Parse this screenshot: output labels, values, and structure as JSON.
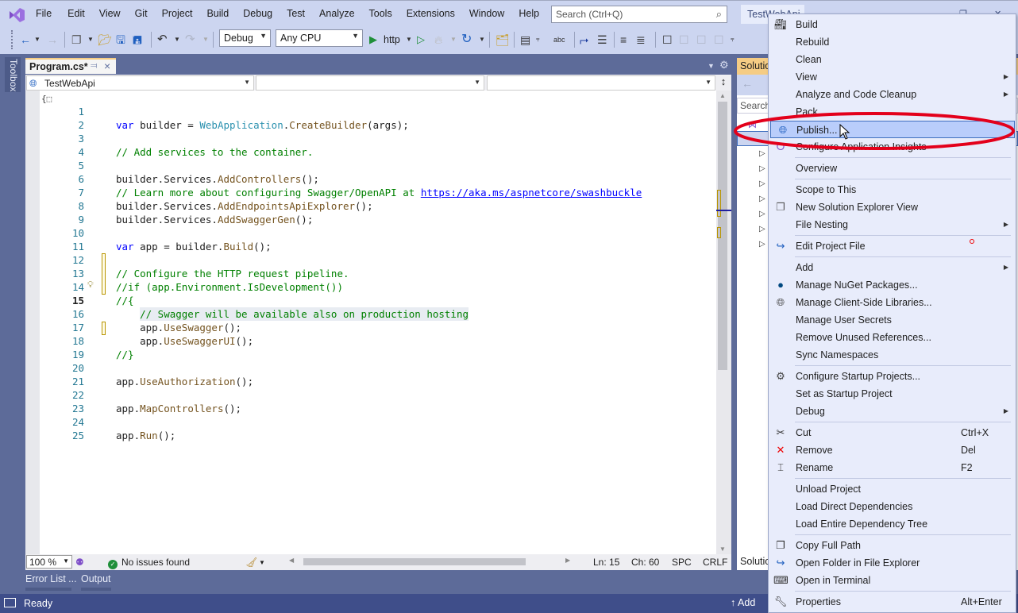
{
  "app": {
    "title_tab": "TestWebApi",
    "accent_color": "#68217a",
    "status_bar_color": "#3f4e8a"
  },
  "menu": [
    "File",
    "Edit",
    "View",
    "Git",
    "Project",
    "Build",
    "Debug",
    "Test",
    "Analyze",
    "Tools",
    "Extensions",
    "Window",
    "Help"
  ],
  "search": {
    "placeholder": "Search (Ctrl+Q)"
  },
  "toolbar": {
    "configuration": "Debug",
    "platform": "Any CPU",
    "run_target": "http"
  },
  "toolbox": {
    "label": "Toolbox"
  },
  "editor": {
    "tab_label": "Program.cs*",
    "nav_project": "TestWebApi",
    "nav_type": "",
    "nav_member": "",
    "current_line": 15,
    "lines": [
      {
        "n": "1"
      },
      {
        "n": "2"
      },
      {
        "n": "3"
      },
      {
        "n": "4"
      },
      {
        "n": "5"
      },
      {
        "n": "6"
      },
      {
        "n": "7"
      },
      {
        "n": "8"
      },
      {
        "n": "9"
      },
      {
        "n": "10"
      },
      {
        "n": "11"
      },
      {
        "n": "12"
      },
      {
        "n": "13"
      },
      {
        "n": "14"
      },
      {
        "n": "15"
      },
      {
        "n": "16"
      },
      {
        "n": "17"
      },
      {
        "n": "18"
      },
      {
        "n": "19"
      },
      {
        "n": "20"
      },
      {
        "n": "21"
      },
      {
        "n": "22"
      },
      {
        "n": "23"
      },
      {
        "n": "24"
      },
      {
        "n": "25"
      }
    ],
    "code": {
      "l1_kw": "var",
      "l1_a": " builder = ",
      "l1_ty": "WebApplication",
      "l1_b": ".",
      "l1_me": "CreateBuilder",
      "l1_c": "(args);",
      "l3": "// Add services to the container.",
      "l5_a": "builder.Services.",
      "l5_me": "AddControllers",
      "l5_b": "();",
      "l6_a": "// Learn more about configuring Swagger/OpenAPI at ",
      "l6_link": "https://aka.ms/aspnetcore/swashbuckle",
      "l7_a": "builder.Services.",
      "l7_me": "AddEndpointsApiExplorer",
      "l7_b": "();",
      "l8_a": "builder.Services.",
      "l8_me": "AddSwaggerGen",
      "l8_b": "();",
      "l10_kw": "var",
      "l10_a": " app = builder.",
      "l10_me": "Build",
      "l10_b": "();",
      "l12": "// Configure the HTTP request pipeline.",
      "l13": "//if (app.Environment.IsDevelopment())",
      "l14": "//{",
      "l15": "    // Swagger will be available also on production hosting",
      "l16_a": "    app.",
      "l16_me": "UseSwagger",
      "l16_b": "();",
      "l17_a": "    app.",
      "l17_me": "UseSwaggerUI",
      "l17_b": "();",
      "l18": "//}",
      "l20_a": "app.",
      "l20_me": "UseAuthorization",
      "l20_b": "();",
      "l22_a": "app.",
      "l22_me": "MapControllers",
      "l22_b": "();",
      "l24_a": "app.",
      "l24_me": "Run",
      "l24_b": "();"
    }
  },
  "editor_status": {
    "zoom": "100 %",
    "issues": "No issues found",
    "line": "Ln: 15",
    "char": "Ch: 60",
    "whitespace": "SPC",
    "line_ending": "CRLF"
  },
  "bottom_tabs": [
    "Error List ...",
    "Output"
  ],
  "statusbar": {
    "ready": "Ready",
    "add_to_source": "Add"
  },
  "solution_explorer": {
    "title": "Solution Explorer",
    "search_placeholder": "Search",
    "bottom_tab": "Solution"
  },
  "context_menu": {
    "items": [
      {
        "label": "Build",
        "icon": "build-icon"
      },
      {
        "label": "Rebuild"
      },
      {
        "label": "Clean"
      },
      {
        "label": "View",
        "submenu": true
      },
      {
        "label": "Analyze and Code Cleanup",
        "submenu": true
      },
      {
        "label": "Pack"
      },
      {
        "label": "Publish...",
        "icon": "globe-publish-icon",
        "highlighted": true
      },
      {
        "label": "Configure Application Insights",
        "icon": "app-insights-icon"
      },
      {
        "label": "Overview"
      },
      {
        "label": "Scope to This"
      },
      {
        "label": "New Solution Explorer View",
        "icon": "new-view-icon"
      },
      {
        "label": "File Nesting",
        "submenu": true
      },
      {
        "label": "Edit Project File",
        "icon": "edit-project-icon"
      },
      {
        "label": "Add",
        "submenu": true
      },
      {
        "label": "Manage NuGet Packages...",
        "icon": "nuget-icon"
      },
      {
        "label": "Manage Client-Side Libraries...",
        "icon": "client-libs-icon"
      },
      {
        "label": "Manage User Secrets"
      },
      {
        "label": "Remove Unused References..."
      },
      {
        "label": "Sync Namespaces"
      },
      {
        "label": "Configure Startup Projects...",
        "icon": "gear-icon"
      },
      {
        "label": "Set as Startup Project"
      },
      {
        "label": "Debug",
        "submenu": true
      },
      {
        "label": "Cut",
        "shortcut": "Ctrl+X",
        "icon": "scissors-icon"
      },
      {
        "label": "Remove",
        "shortcut": "Del",
        "icon": "remove-icon"
      },
      {
        "label": "Rename",
        "shortcut": "F2",
        "icon": "rename-icon"
      },
      {
        "label": "Unload Project"
      },
      {
        "label": "Load Direct Dependencies"
      },
      {
        "label": "Load Entire Dependency Tree"
      },
      {
        "label": "Copy Full Path",
        "icon": "copy-icon"
      },
      {
        "label": "Open Folder in File Explorer",
        "icon": "open-folder-icon"
      },
      {
        "label": "Open in Terminal",
        "icon": "terminal-icon"
      },
      {
        "label": "Properties",
        "shortcut": "Alt+Enter",
        "icon": "wrench-icon"
      }
    ]
  },
  "annotation": {
    "highlight_color": "#e3001b",
    "target": "Publish..."
  }
}
